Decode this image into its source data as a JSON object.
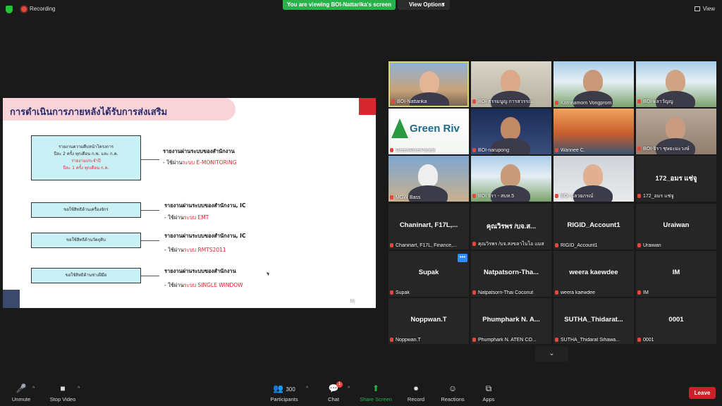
{
  "topbar": {
    "recording_label": "Recording",
    "viewing_banner": "You are viewing BOI-Nattarika's screen",
    "view_options_label": "View Options",
    "view_label": "View"
  },
  "slide": {
    "title": "การดำเนินการภายหลังได้รับการส่งเสริม",
    "box1_line1": "รายงานความคืบหน้าโครงการ",
    "box1_line2": "ปีละ 2 ครั้ง ทุกเดือน ก.พ. และ ก.ค.",
    "box1_line3": "รายงานประจำปี",
    "box1_line4": "ปีละ 1 ครั้ง ทุกเดือน ก.ค.",
    "box2": "ขอใช้สิทธิด้านเครื่องจักร",
    "box3": "ขอใช้สิทธิด้านวัตถุดิบ",
    "box4": "ขอใช้สิทธิด้านช่างฝีมือ",
    "r1_title": "รายงานผ่านระบบของสำนักงาน",
    "r1_sub_prefix": "- ใช้ผ่าน",
    "r1_sub_system": "ระบบ E-MONITORING",
    "r2_title": "รายงานผ่านระบบของสำนักงาน, IC",
    "r2_sub_prefix": "- ใช้ผ่าน",
    "r2_sub_system": "ระบบ EMT",
    "r3_title": "รายงานผ่านระบบของสำนักงาน, IC",
    "r3_sub_prefix": "- ใช้ผ่าน",
    "r3_sub_system": "ระบบ RMTS2011",
    "r4_title": "รายงานผ่านระบบของสำนักงาน",
    "r4_sub_prefix": "- ใช้ผ่าน",
    "r4_sub_system": "ระบบ SINGLE WINDOW",
    "page_number": "55"
  },
  "gallery": {
    "video_tiles": [
      {
        "caption": "BOI-Nattarika"
      },
      {
        "caption": "BOI-ธรรมนูญ การสวรรณ"
      },
      {
        "caption": "Kornnamorn Vongprom"
      },
      {
        "caption": "BOI-ผลาวัญญู"
      },
      {
        "caption": "GreenRiverPanels",
        "logo_text": "Green Riv"
      },
      {
        "caption": "BOI-narupong"
      },
      {
        "caption": "Wannee C."
      },
      {
        "caption": "BOI-จิรา ชุษยะมะวงษ์"
      },
      {
        "caption": "MGW Bass"
      },
      {
        "caption": "BOI จิรา - สบท.5"
      },
      {
        "caption": "BOI-ฉลวยภรณ์"
      },
      {
        "caption": "172_อมร แช่จู",
        "bigname": "172_อมร แช่จู"
      }
    ],
    "name_tiles": [
      {
        "bigname": "Chaninart, F17L,...",
        "caption": "Chaninart, F17L, Finance,..."
      },
      {
        "bigname": "คุณวิรพร /บจ.ส...",
        "caption": "คุณวิรพร /บจ.สงขลาไบโอ แมส"
      },
      {
        "bigname": "RIGID_Account1",
        "caption": "RIGID_Account1"
      },
      {
        "bigname": "Uraiwan",
        "caption": "Uraiwan"
      },
      {
        "bigname": "Supak",
        "caption": "Supak"
      },
      {
        "bigname": "Natpatsorn-Tha...",
        "caption": "Natpatsorn-Thai Coconut"
      },
      {
        "bigname": "weera kaewdee",
        "caption": "weera kaewdee"
      },
      {
        "bigname": "IM",
        "caption": "IM"
      },
      {
        "bigname": "Noppwan.T",
        "caption": "Noppwan.T"
      },
      {
        "bigname": "Phumphark N. A...",
        "caption": "Phumphark N. ATEN CO..."
      },
      {
        "bigname": "SUTHA_Thidarat...",
        "caption": "SUTHA_Thidarat Sihawa..."
      },
      {
        "bigname": "0001",
        "caption": "0001"
      }
    ],
    "tile_menu_glyph": "•••",
    "more_chevron": "⌄"
  },
  "toolbar": {
    "unmute": "Unmute",
    "stop_video": "Stop Video",
    "participants": "Participants",
    "participants_count": "300",
    "chat": "Chat",
    "chat_badge": "1",
    "share_screen": "Share Screen",
    "record": "Record",
    "reactions": "Reactions",
    "apps": "Apps",
    "leave": "Leave"
  }
}
